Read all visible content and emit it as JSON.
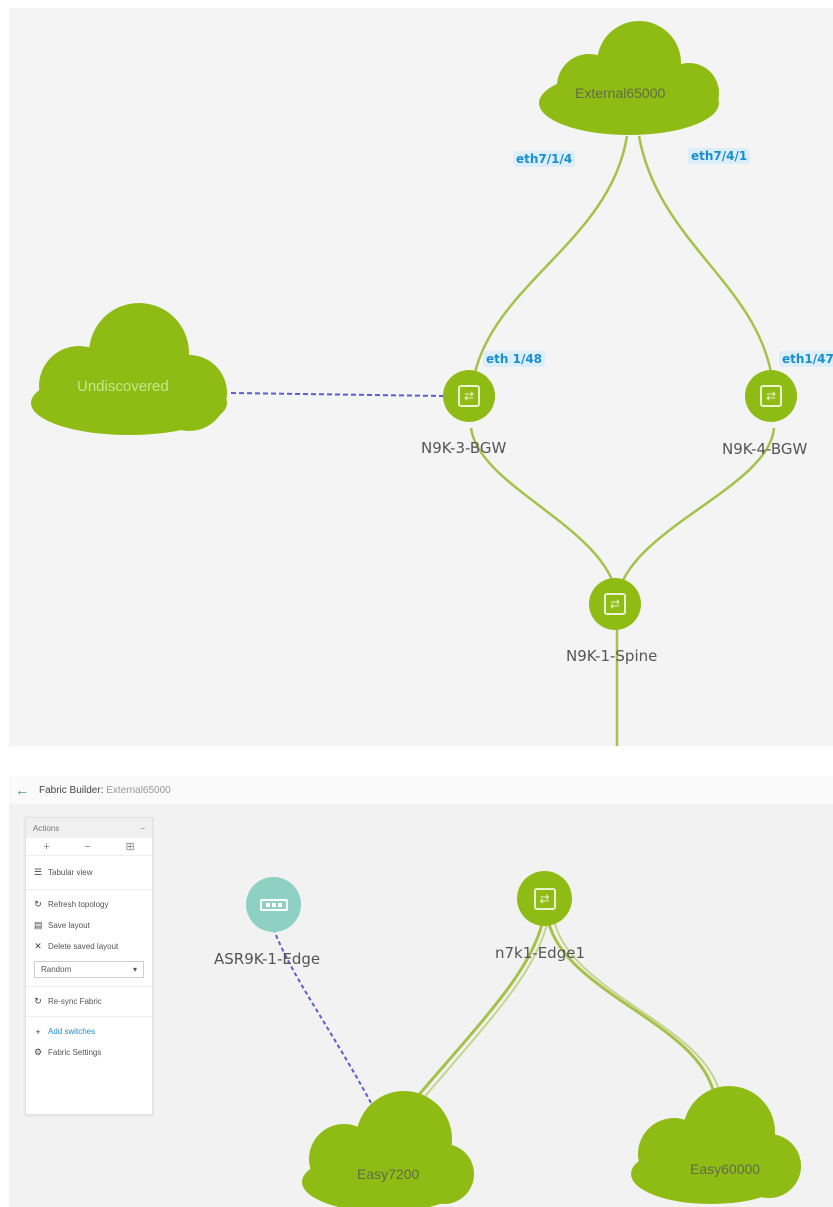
{
  "top_topology": {
    "clouds": {
      "external": "External65000",
      "undiscovered": "Undiscovered"
    },
    "ports": {
      "ext_left": "eth7/1/4",
      "ext_right": "eth7/4/1",
      "bgw3_port": "eth 1/48",
      "bgw4_port": "eth1/47"
    },
    "switches": {
      "bgw3": "N9K-3-BGW",
      "bgw4": "N9K-4-BGW",
      "spine": "N9K-1-Spine"
    }
  },
  "fabric_builder": {
    "header": {
      "title": "Fabric Builder:",
      "fabric": "External65000"
    },
    "actions": {
      "title": "Actions",
      "collapse": "−",
      "zoom_in": "+",
      "zoom_out": "−",
      "fit": "⊞",
      "tabular_view": "Tabular view",
      "refresh_topology": "Refresh topology",
      "save_layout": "Save layout",
      "delete_saved_layout": "Delete saved layout",
      "layout_select": "Random",
      "resync_fabric": "Re-sync Fabric",
      "add_switches": "Add switches",
      "fabric_settings": "Fabric Settings"
    },
    "nodes": {
      "asr": "ASR9K-1-Edge",
      "n7k": "n7k1-Edge1"
    },
    "clouds": {
      "easy7200": "Easy7200",
      "easy60000": "Easy60000"
    }
  },
  "colors": {
    "node_green": "#8fbc14",
    "node_teal": "#8fd0c5",
    "link_green": "#a8c04a",
    "link_blue_dash": "#5a5ec8",
    "port_blue": "#1a8fd0"
  }
}
